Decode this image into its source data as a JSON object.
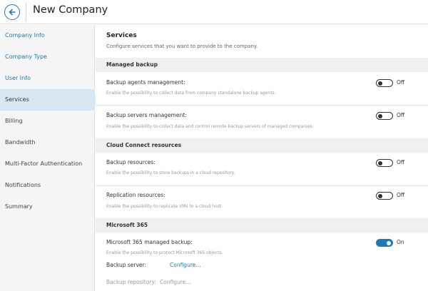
{
  "header": {
    "title": "New Company",
    "back_icon": "arrow-left-icon"
  },
  "colors": {
    "accent": "#1a7bb9",
    "sidebar_bg": "#f5f5f5",
    "sidebar_active_bg": "#d6e8f6",
    "section_band_bg": "#f0f0f0"
  },
  "sidebar": {
    "items": [
      {
        "label": "Company Info",
        "state": "link"
      },
      {
        "label": "Company Type",
        "state": "link"
      },
      {
        "label": "User Info",
        "state": "link"
      },
      {
        "label": "Services",
        "state": "active"
      },
      {
        "label": "Billing",
        "state": "normal"
      },
      {
        "label": "Bandwidth",
        "state": "normal"
      },
      {
        "label": "Multi-Factor Authentication",
        "state": "normal"
      },
      {
        "label": "Notifications",
        "state": "normal"
      },
      {
        "label": "Summary",
        "state": "normal"
      }
    ]
  },
  "main": {
    "title": "Services",
    "subtitle": "Configure services that you want to provide to the company.",
    "sections": [
      {
        "heading": "Managed backup",
        "rows": [
          {
            "label": "Backup agents management:",
            "description": "Enable the possibility to collect data from company standalone backup agents.",
            "toggle_on": false,
            "toggle_text": "Off"
          },
          {
            "label": "Backup servers management:",
            "description": "Enable the possibility to collect data and control remote backup servers of managed companies.",
            "toggle_on": false,
            "toggle_text": "Off"
          }
        ]
      },
      {
        "heading": "Cloud Connect resources",
        "rows": [
          {
            "label": "Backup resources:",
            "description": "Enable the possibility to store backups in a cloud repository.",
            "toggle_on": false,
            "toggle_text": "Off"
          },
          {
            "label": "Replication resources:",
            "description": "Enable the possibility to replicate VMs to a cloud host.",
            "toggle_on": false,
            "toggle_text": "Off"
          }
        ]
      },
      {
        "heading": "Microsoft 365",
        "rows": [
          {
            "label": "Microsoft 365 managed backup:",
            "description": "Enable the possibility to protect Microsoft 365 objects.",
            "toggle_on": true,
            "toggle_text": "On"
          }
        ],
        "settings": [
          {
            "label": "Backup server:",
            "link": "Configure...",
            "enabled": true
          },
          {
            "label": "Backup repository:",
            "link": "Configure...",
            "enabled": false
          }
        ]
      }
    ]
  }
}
